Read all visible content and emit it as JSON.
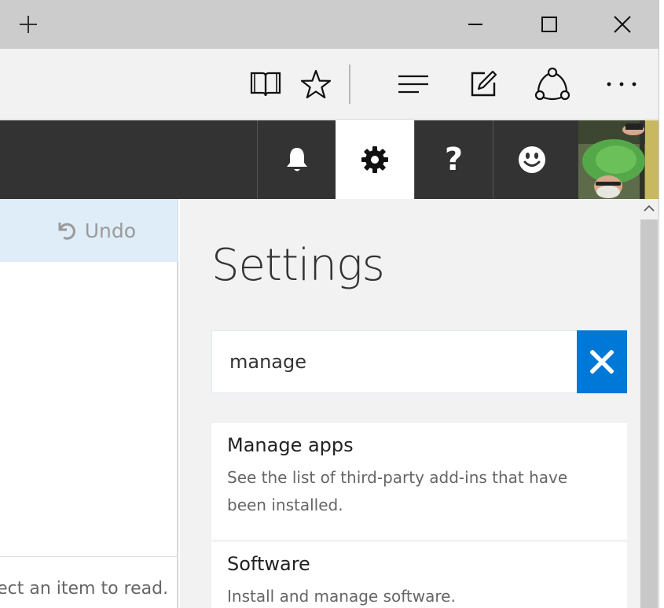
{
  "toolbar": {
    "icons": [
      "reading-view-icon",
      "favorite-star-icon",
      "hub-icon",
      "web-note-icon",
      "share-icon",
      "more-icon"
    ]
  },
  "window": {
    "controls": [
      "new-tab-icon",
      "minimize-icon",
      "maximize-icon",
      "close-icon"
    ]
  },
  "header": {
    "buttons": [
      "bell-icon",
      "gear-icon",
      "help-icon",
      "smiley-icon"
    ],
    "help_label": "?",
    "active": "settings"
  },
  "left_pane": {
    "undo_label": "Undo",
    "hint_text": "lect an item to read."
  },
  "settings": {
    "title": "Settings",
    "search_value": "manage",
    "results": [
      {
        "title": "Manage apps",
        "description": "See the list of third-party add-ins that have been installed."
      },
      {
        "title": "Software",
        "description": "Install and manage software."
      }
    ]
  },
  "colors": {
    "title_bar": "#cccccc",
    "app_header": "#333333",
    "accent": "#0078d7",
    "undo_bar": "#deedf8",
    "settings_bg": "#f2f2f2"
  }
}
